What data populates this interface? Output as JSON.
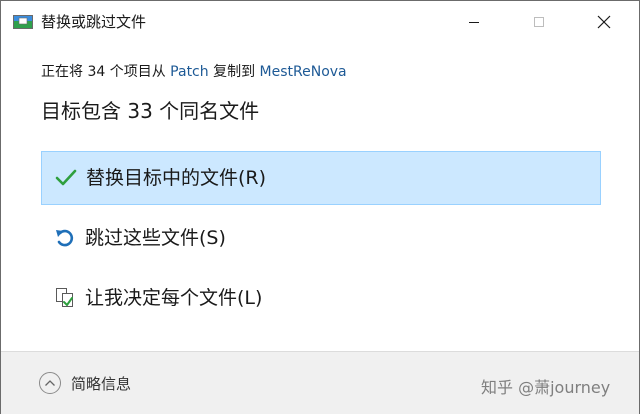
{
  "window": {
    "title": "替换或跳过文件"
  },
  "message": {
    "prefix": "正在将 34 个项目从 ",
    "source": "Patch",
    "middle": " 复制到 ",
    "destination": "MestReNova",
    "heading": "目标包含 33 个同名文件"
  },
  "options": [
    {
      "label": "替换目标中的文件(R)",
      "icon": "checkmark-icon",
      "selected": true
    },
    {
      "label": "跳过这些文件(S)",
      "icon": "undo-arrow-icon",
      "selected": false
    },
    {
      "label": "让我决定每个文件(L)",
      "icon": "compare-files-icon",
      "selected": false
    }
  ],
  "footer": {
    "details_label": "简略信息",
    "watermark": "知乎 @萧journey"
  },
  "colors": {
    "accent": "#0078d7",
    "selection_bg": "#cce8ff",
    "selection_border": "#99d1ff",
    "link": "#1e5a96",
    "check": "#2e9f3e",
    "undo": "#1f6fb8"
  }
}
